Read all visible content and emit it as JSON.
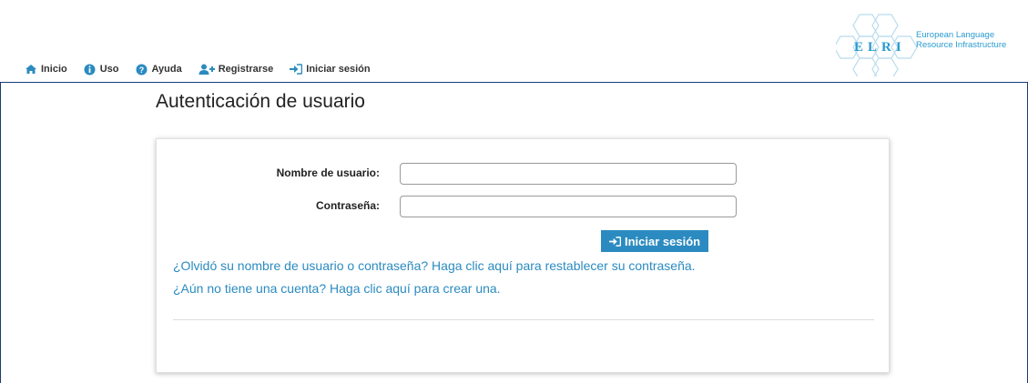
{
  "nav": {
    "items": [
      {
        "label": "Inicio",
        "icon": "home-icon"
      },
      {
        "label": "Uso",
        "icon": "info-icon"
      },
      {
        "label": "Ayuda",
        "icon": "help-icon"
      },
      {
        "label": "Registrarse",
        "icon": "add-user-icon"
      },
      {
        "label": "Iniciar sesión",
        "icon": "sign-in-icon"
      }
    ]
  },
  "logo": {
    "letters": "ELRI",
    "line1": "European Language",
    "line2": "Resource Infrastructure"
  },
  "main": {
    "title": "Autenticación de usuario",
    "username_label": "Nombre de usuario:",
    "username_value": "",
    "password_label": "Contraseña:",
    "password_value": "",
    "login_button": "Iniciar sesión",
    "forgot_link": "¿Olvidó su nombre de usuario o contraseña? Haga clic aquí para restablecer su contraseña.",
    "register_link": "¿Aún no tiene una cuenta? Haga clic aquí para crear una."
  },
  "colors": {
    "accent": "#2b8bc0",
    "frame": "#1a3d74",
    "logo": "#2a9bd0"
  }
}
